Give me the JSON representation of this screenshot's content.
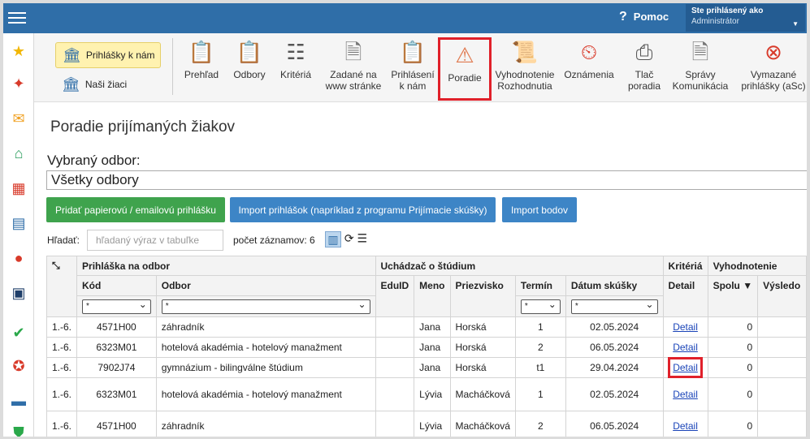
{
  "header": {
    "help_label": "Pomoc",
    "help_icon": "?",
    "user_line1": "Ste prihlásený ako",
    "user_line2": "Administrátor"
  },
  "sidebar": [
    "star-icon",
    "wand-icon",
    "mail-icon",
    "home-icon",
    "calendar-icon",
    "book-icon",
    "person-icon",
    "schedule-icon",
    "check-icon",
    "badge-icon",
    "briefcase-icon",
    "shield-icon"
  ],
  "toolbar": {
    "prihlasky_label": "Prihlášky k nám",
    "ziaci_label": "Naši žiaci",
    "items": [
      {
        "l1": "Prehľad",
        "l2": ""
      },
      {
        "l1": "Odbory",
        "l2": ""
      },
      {
        "l1": "Kritériá",
        "l2": ""
      },
      {
        "l1": "Zadané na",
        "l2": "www stránke"
      },
      {
        "l1": "Prihlásení",
        "l2": "k nám"
      },
      {
        "l1": "Poradie",
        "l2": ""
      },
      {
        "l1": "Vyhodnotenie",
        "l2": "Rozhodnutia"
      },
      {
        "l1": "Oznámenia",
        "l2": ""
      },
      {
        "l1": "Tlač",
        "l2": "poradia"
      },
      {
        "l1": "Správy",
        "l2": "Komunikácia"
      },
      {
        "l1": "Vymazané",
        "l2": "prihlášky (aSc)"
      }
    ]
  },
  "page": {
    "title": "Poradie prijímaných žiakov",
    "odbor_label": "Vybraný odbor:",
    "odbor_value": "Všetky odbory"
  },
  "buttons": {
    "add": "Pridať papierovú / emailovú prihlášku",
    "import": "Import prihlášok (napríklad z programu Prijímacie skúšky)",
    "bodov": "Import bodov"
  },
  "search": {
    "label": "Hľadať:",
    "placeholder": "hľadaný výraz v tabuľke",
    "count": "počet záznamov: 6"
  },
  "table": {
    "groups": {
      "prihlaska": "Prihláška na odbor",
      "uchadzac": "Uchádzač o štúdium",
      "kriteria": "Kritériá",
      "vyhodnotenie": "Vyhodnotenie"
    },
    "cols": {
      "kod": "Kód",
      "odbor": "Odbor",
      "eduid": "EduID",
      "meno": "Meno",
      "priezvisko": "Priezvisko",
      "termin": "Termín",
      "datum": "Dátum skúšky",
      "detail": "Detail",
      "spolu": "Spolu",
      "vysledok": "Výsledo"
    },
    "filter_value": "*",
    "rows": [
      {
        "rank": "1.-6.",
        "kod": "4571H00",
        "odbor": "záhradník",
        "eduid": "",
        "meno": "Jana",
        "priezvisko": "Horská",
        "termin": "1",
        "datum": "02.05.2024",
        "detail": "Detail",
        "spolu": "0"
      },
      {
        "rank": "1.-6.",
        "kod": "6323M01",
        "odbor": "hotelová akadémia - hotelový manažment",
        "eduid": "",
        "meno": "Jana",
        "priezvisko": "Horská",
        "termin": "2",
        "datum": "06.05.2024",
        "detail": "Detail",
        "spolu": "0"
      },
      {
        "rank": "1.-6.",
        "kod": "7902J74",
        "odbor": "gymnázium - bilingválne štúdium",
        "eduid": "",
        "meno": "Jana",
        "priezvisko": "Horská",
        "termin": "t1",
        "datum": "29.04.2024",
        "detail": "Detail",
        "spolu": "0"
      },
      {
        "rank": "1.-6.",
        "kod": "6323M01",
        "odbor": "hotelová akadémia - hotelový manažment",
        "eduid": "",
        "meno": "Lývia",
        "priezvisko": "Macháčková",
        "termin": "1",
        "datum": "02.05.2024",
        "detail": "Detail",
        "spolu": "0"
      },
      {
        "rank": "1.-6.",
        "kod": "4571H00",
        "odbor": "záhradník",
        "eduid": "",
        "meno": "Lývia",
        "priezvisko": "Macháčková",
        "termin": "2",
        "datum": "06.05.2024",
        "detail": "Detail",
        "spolu": "0"
      }
    ]
  }
}
